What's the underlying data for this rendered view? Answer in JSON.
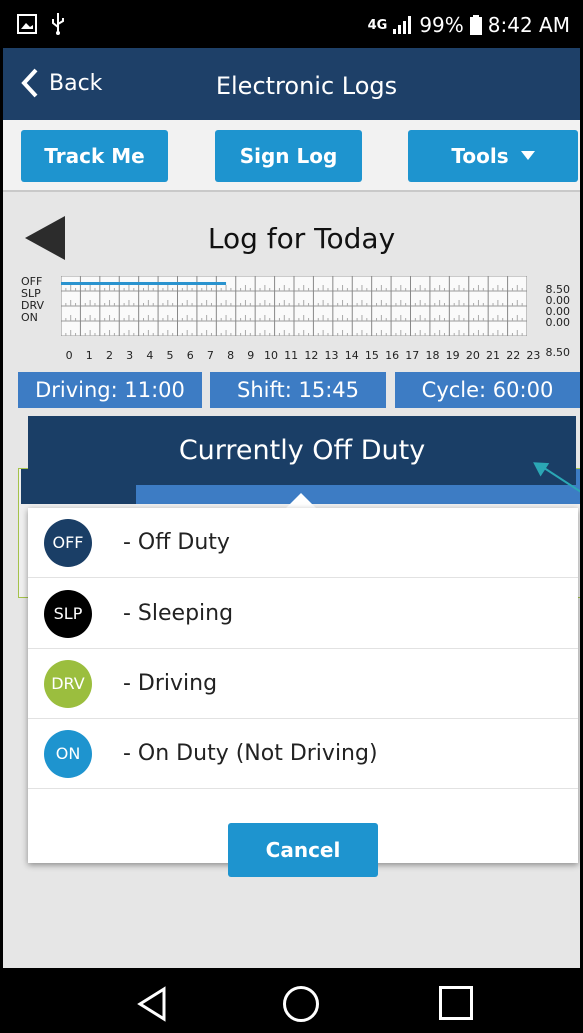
{
  "status_bar": {
    "network": "4G",
    "battery": "99%",
    "time": "8:42 AM"
  },
  "header": {
    "back_label": "Back",
    "title": "Electronic Logs"
  },
  "toolbar": {
    "track_label": "Track Me",
    "sign_label": "Sign Log",
    "tools_label": "Tools"
  },
  "log": {
    "title": "Log for Today",
    "row_labels": [
      "OFF",
      "SLP",
      "DRV",
      "ON"
    ],
    "row_totals": [
      "8.50",
      "0.00",
      "0.00",
      "0.00"
    ],
    "grand_total": "8.50",
    "hours": [
      "0",
      "1",
      "2",
      "3",
      "4",
      "5",
      "6",
      "7",
      "8",
      "9",
      "10",
      "11",
      "12",
      "13",
      "14",
      "15",
      "16",
      "17",
      "18",
      "19",
      "20",
      "21",
      "22",
      "23"
    ],
    "off_duty_until_hour": 8.5
  },
  "totals": {
    "driving": "Driving: 11:00",
    "shift": "Shift: 15:45",
    "cycle": "Cycle: 60:00"
  },
  "current_status": "Currently Off Duty",
  "status_popup": {
    "options": [
      {
        "code": "OFF",
        "label": "- Off Duty",
        "color": "#1a3e66"
      },
      {
        "code": "SLP",
        "label": "- Sleeping",
        "color": "#000000"
      },
      {
        "code": "DRV",
        "label": "- Driving",
        "color": "#9bbe3e"
      },
      {
        "code": "ON",
        "label": "- On Duty (Not Driving)",
        "color": "#1e94cf"
      }
    ],
    "cancel_label": "Cancel"
  },
  "colors": {
    "header_bg": "#1e4068",
    "button_bg": "#1e94cf",
    "totals_bg": "#3d7cc4",
    "status_bg": "#1a3e66",
    "grid_line": "#2a93cf"
  }
}
